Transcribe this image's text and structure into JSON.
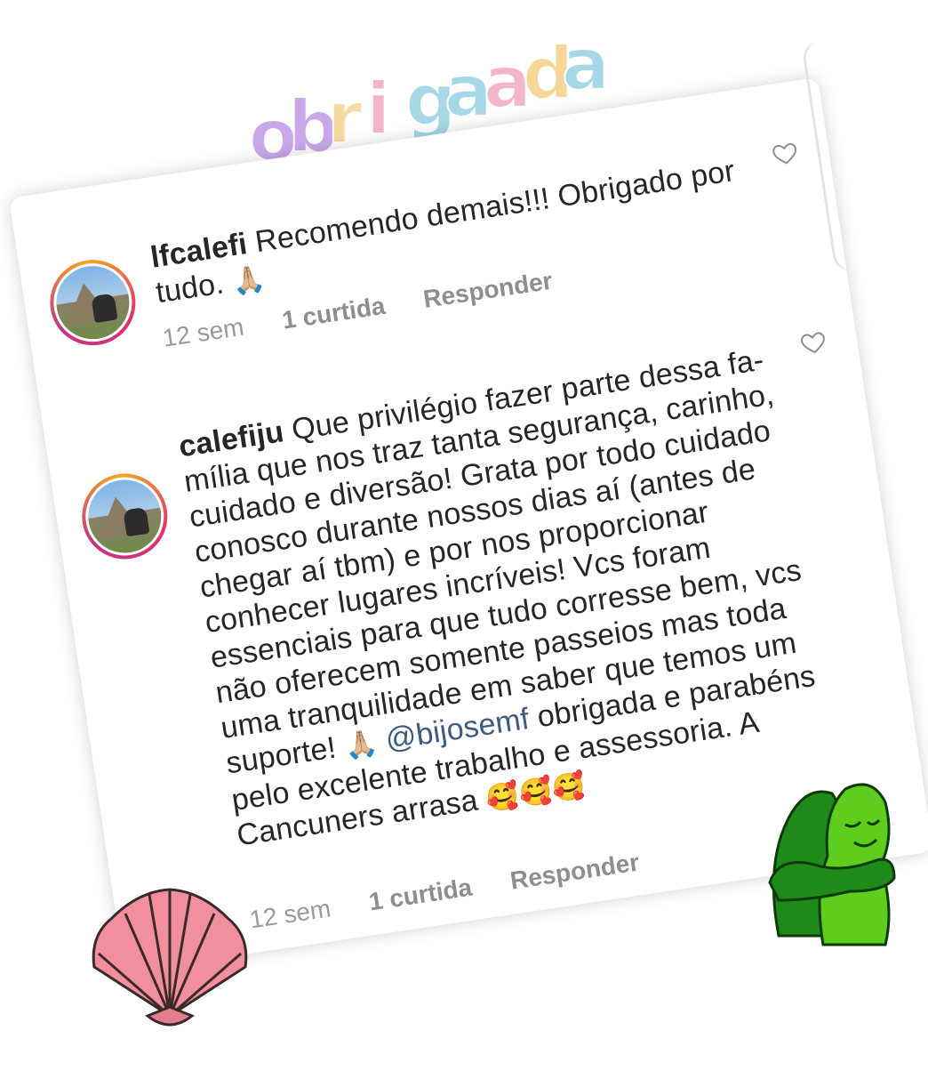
{
  "decor": {
    "title_letters": [
      "o",
      "b",
      "r",
      "i",
      "g",
      "a",
      "a",
      "d",
      "a"
    ],
    "title_colors": [
      "#c9a7ea",
      "#c9a7ea",
      "#f7d9a4",
      "#f2b6c8",
      "#a7d8e8",
      "#a7d8e8",
      "#f2b6c8",
      "#f6d79a",
      "#a7d8e8"
    ],
    "shell_color": "#f28f9f",
    "hug_colors": [
      "#1f8a1a",
      "#5fcd1e"
    ]
  },
  "comments": [
    {
      "username": "lfcalefi",
      "text": "Recomendo demais!!! Obrigado por tudo.",
      "emoji": "🙏🏼",
      "time": "12 sem",
      "likes": "1 curtida",
      "reply": "Responder",
      "icon": "heart-outline-icon"
    },
    {
      "username": "calefiju",
      "text": "Que privilégio fazer parte dessa fa- mília que nos traz tanta segurança, carinho, cuidado e diversão! Grata por todo cuidado conosco durante nossos dias aí (antes de chegar aí tbm) e por nos proporcionar conhecer lugares incríveis! Vcs foram essenciais para que tudo corresse bem, vcs não oferecem somente passeios mas toda uma tranquilidade em saber que temos um suporte!",
      "emoji1": "🙏🏼",
      "mention": "@bijosemf",
      "text2": "obrigada e parabéns pelo excelente trabalho e assessoria. A Cancuners arrasa",
      "emoji2": "🥰🥰🥰",
      "time": "12 sem",
      "likes": "1 curtida",
      "reply": "Responder",
      "icon": "heart-outline-icon"
    }
  ]
}
